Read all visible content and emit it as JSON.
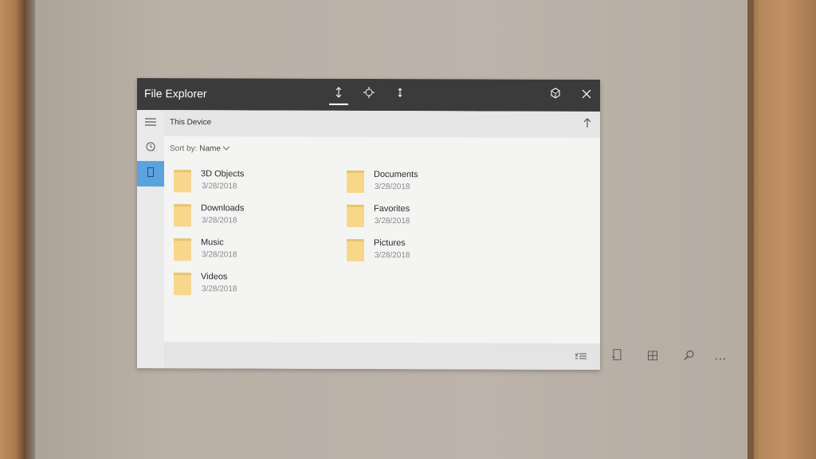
{
  "window": {
    "title": "File Explorer",
    "titlebar_icons": [
      "scroll-mode-icon",
      "move-icon",
      "scale-icon",
      "hologram-icon",
      "close-icon"
    ]
  },
  "sidebar": {
    "items": [
      {
        "icon": "menu-icon"
      },
      {
        "icon": "recent-icon"
      },
      {
        "icon": "this-device-icon",
        "active": true
      }
    ]
  },
  "path": {
    "location": "This Device"
  },
  "sort": {
    "label": "Sort by:",
    "value": "Name"
  },
  "folders": [
    {
      "name": "3D Objects",
      "date": "3/28/2018"
    },
    {
      "name": "Documents",
      "date": "3/28/2018"
    },
    {
      "name": "Downloads",
      "date": "3/28/2018"
    },
    {
      "name": "Favorites",
      "date": "3/28/2018"
    },
    {
      "name": "Music",
      "date": "3/28/2018"
    },
    {
      "name": "Pictures",
      "date": "3/28/2018"
    },
    {
      "name": "Videos",
      "date": "3/28/2018"
    }
  ],
  "bottombar": {
    "icons": [
      "select-icon",
      "new-window-icon",
      "view-icon",
      "search-icon",
      "more-icon"
    ]
  },
  "colors": {
    "titlebar": "#3b3b3b",
    "accent": "#5ba3de",
    "folder": "#f7d88a"
  }
}
